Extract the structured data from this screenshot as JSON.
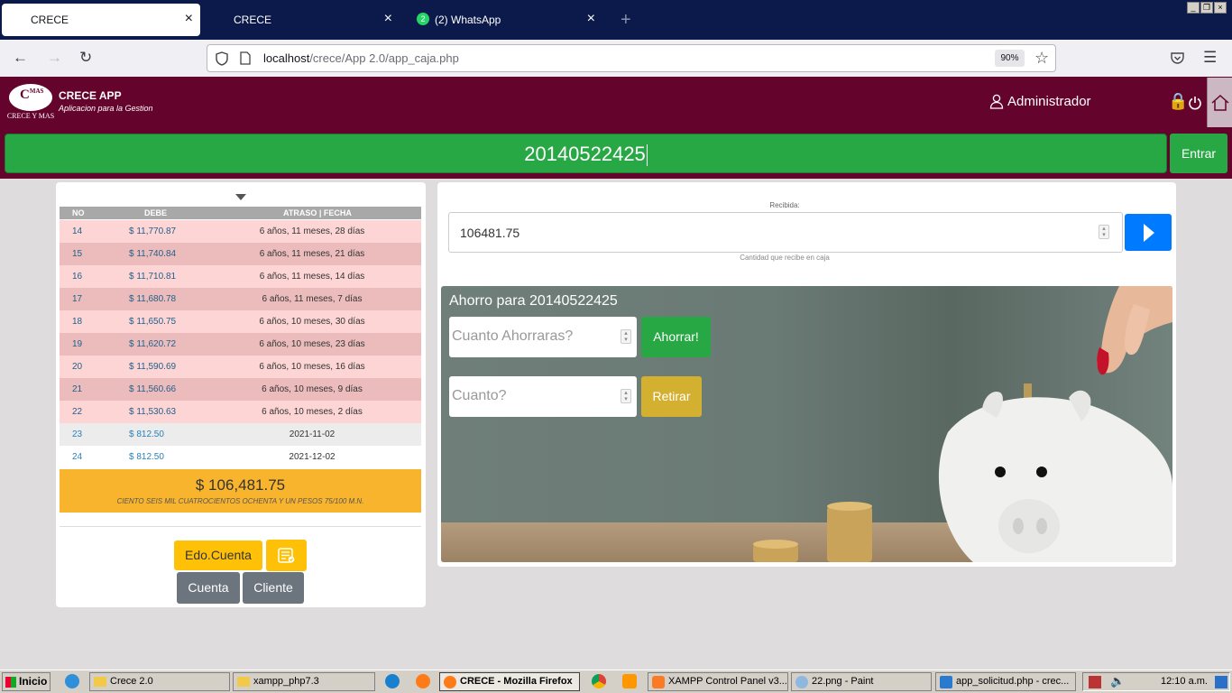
{
  "browser": {
    "tabs": [
      {
        "label": "CRECE",
        "active": true
      },
      {
        "label": "CRECE",
        "active": false
      },
      {
        "label": "(2) WhatsApp",
        "active": false,
        "badge": "2"
      }
    ],
    "url_host": "localhost",
    "url_path": "/crece/App 2.0/app_caja.php",
    "zoom": "90%"
  },
  "header": {
    "logo_mark": "C",
    "logo_sup": "MAS",
    "logo_text": "CRECE Y MAS",
    "title": "CRECE APP",
    "subtitle": "Aplicacion para la Gestion",
    "user": "Administrador"
  },
  "scan": {
    "value": "20140522425",
    "enter_label": "Entrar"
  },
  "table": {
    "columns": [
      "NO",
      "DEBE",
      "ATRASO | FECHA"
    ],
    "rows": [
      {
        "no": "14",
        "debe": "$ 11,770.87",
        "date": "6 años, 11 meses, 28 días"
      },
      {
        "no": "15",
        "debe": "$ 11,740.84",
        "date": "6 años, 11 meses, 21 días"
      },
      {
        "no": "16",
        "debe": "$ 11,710.81",
        "date": "6 años, 11 meses, 14 días"
      },
      {
        "no": "17",
        "debe": "$ 11,680.78",
        "date": "6 años, 11 meses, 7 días"
      },
      {
        "no": "18",
        "debe": "$ 11,650.75",
        "date": "6 años, 10 meses, 30 días"
      },
      {
        "no": "19",
        "debe": "$ 11,620.72",
        "date": "6 años, 10 meses, 23 días"
      },
      {
        "no": "20",
        "debe": "$ 11,590.69",
        "date": "6 años, 10 meses, 16 días"
      },
      {
        "no": "21",
        "debe": "$ 11,560.66",
        "date": "6 años, 10 meses, 9 días"
      },
      {
        "no": "22",
        "debe": "$ 11,530.63",
        "date": "6 años, 10 meses, 2 días"
      },
      {
        "no": "23",
        "debe": "$ 812.50",
        "date": "2021-11-02"
      },
      {
        "no": "24",
        "debe": "$ 812.50",
        "date": "2021-12-02"
      }
    ],
    "total": "$ 106,481.75",
    "total_words": "CIENTO SEIS MIL CUATROCIENTOS OCHENTA Y UN PESOS 75/100 M.N."
  },
  "actions": {
    "edo_cuenta": "Edo.Cuenta",
    "cuenta": "Cuenta",
    "cliente": "Cliente"
  },
  "payment": {
    "label": "Recibida:",
    "value": "106481.75",
    "hint": "Cantidad que recibe en caja"
  },
  "savings": {
    "title": "Ahorro para 20140522425",
    "deposit_placeholder": "Cuanto Ahorraras?",
    "deposit_button": "Ahorrar!",
    "withdraw_placeholder": "Cuanto?",
    "withdraw_button": "Retirar"
  },
  "taskbar": {
    "start": "Inicio",
    "items": [
      "Crece 2.0",
      "xampp_php7.3",
      "CRECE - Mozilla Firefox",
      "XAMPP Control Panel v3....",
      "22.png - Paint",
      "app_solicitud.php - crec..."
    ],
    "clock": "12:10 a.m."
  },
  "colors": {
    "brand": "#64032c",
    "success": "#28a745",
    "warning": "#ffc107",
    "primary": "#007bff",
    "overdue_row": "#fdd5d5"
  }
}
